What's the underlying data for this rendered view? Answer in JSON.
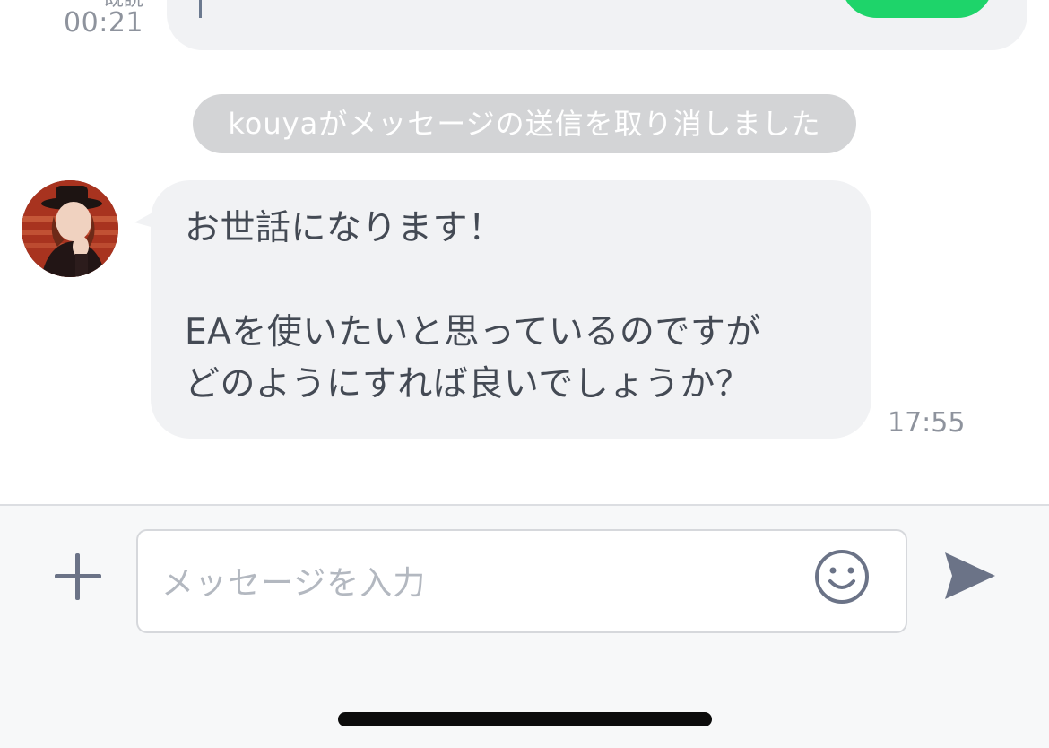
{
  "previous_message": {
    "read_label": "既読",
    "time": "00:21"
  },
  "system_notice": {
    "text": "kouyaがメッセージの送信を取り消しました"
  },
  "incoming_message": {
    "sender_avatar": "avatar-image",
    "text": "お世話になります！\n\nEAを使いたいと思っているのですが\nどのようにすれば良いでしょうか？",
    "time": "17:55"
  },
  "composer": {
    "placeholder": "メッセージを入力",
    "value": "",
    "icons": {
      "add": "plus-icon",
      "emoji": "smiley-icon",
      "send": "send-icon"
    }
  },
  "colors": {
    "bubble_bg": "#f1f2f4",
    "notice_bg": "#d3d4d6",
    "accent_green": "#1ed46a",
    "icon_color": "#6b7387"
  }
}
